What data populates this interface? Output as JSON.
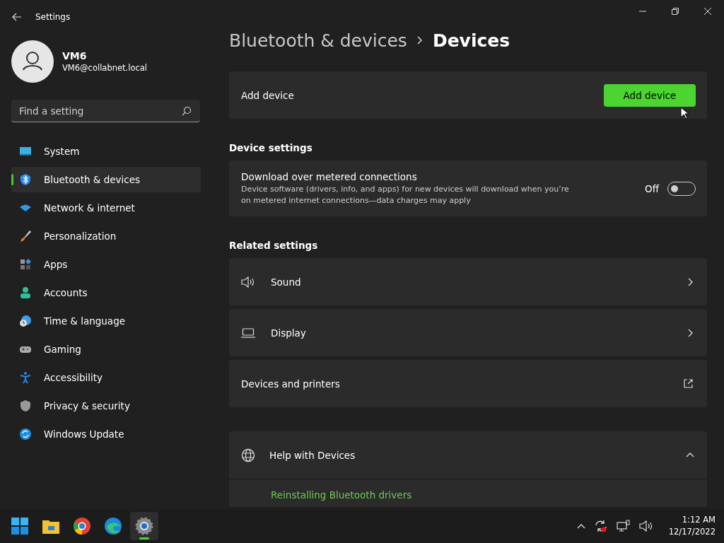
{
  "window": {
    "title": "Settings"
  },
  "user": {
    "name": "VM6",
    "email": "VM6@collabnet.local"
  },
  "search": {
    "placeholder": "Find a setting"
  },
  "sidebar": {
    "items": [
      {
        "label": "System",
        "kind": "system",
        "selected": false
      },
      {
        "label": "Bluetooth & devices",
        "kind": "bluetooth",
        "selected": true
      },
      {
        "label": "Network & internet",
        "kind": "network",
        "selected": false
      },
      {
        "label": "Personalization",
        "kind": "brush",
        "selected": false
      },
      {
        "label": "Apps",
        "kind": "apps",
        "selected": false
      },
      {
        "label": "Accounts",
        "kind": "accounts",
        "selected": false
      },
      {
        "label": "Time & language",
        "kind": "time",
        "selected": false
      },
      {
        "label": "Gaming",
        "kind": "gaming",
        "selected": false
      },
      {
        "label": "Accessibility",
        "kind": "accessibility",
        "selected": false
      },
      {
        "label": "Privacy & security",
        "kind": "privacy",
        "selected": false
      },
      {
        "label": "Windows Update",
        "kind": "update",
        "selected": false
      }
    ]
  },
  "breadcrumb": [
    "Bluetooth & devices",
    "Devices"
  ],
  "add_device": {
    "label": "Add device",
    "button": "Add device"
  },
  "device_settings": {
    "heading": "Device settings",
    "items": [
      {
        "title": "Download over metered connections",
        "description": "Device software (drivers, info, and apps) for new devices will download when you’re on metered internet connections—data charges may apply",
        "state_label": "Off",
        "on": false
      }
    ]
  },
  "related_settings": {
    "heading": "Related settings",
    "items": [
      {
        "label": "Sound",
        "kind": "sound"
      },
      {
        "label": "Display",
        "kind": "display"
      },
      {
        "label": "Devices and printers",
        "kind": "external"
      }
    ]
  },
  "help": {
    "label": "Help with Devices",
    "expanded": true,
    "links": [
      "Reinstalling Bluetooth drivers"
    ]
  },
  "taskbar": {
    "apps": [
      {
        "kind": "start",
        "active": false
      },
      {
        "kind": "explorer",
        "active": false
      },
      {
        "kind": "chrome",
        "active": false
      },
      {
        "kind": "edge",
        "active": false
      },
      {
        "kind": "settings",
        "active": true
      }
    ],
    "time": "1:12 AM",
    "date": "12/17/2022"
  }
}
